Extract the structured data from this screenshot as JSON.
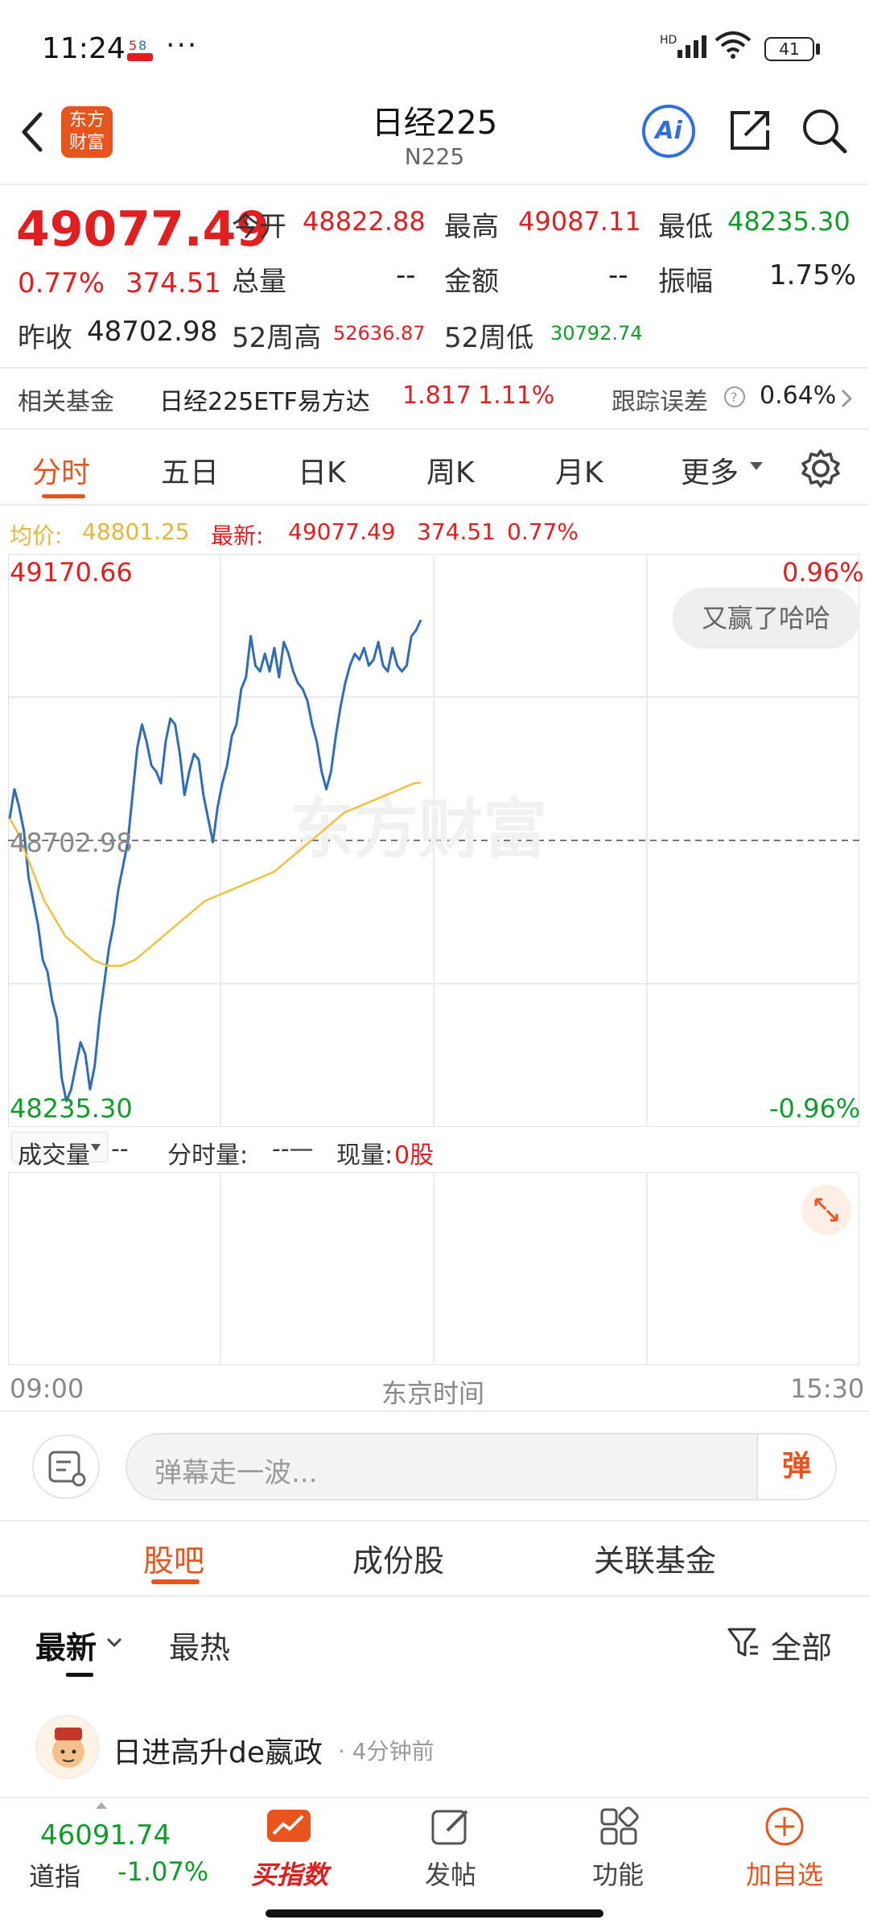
{
  "status_bar": {
    "time": "11:24",
    "dots": "···",
    "battery": "41",
    "network": "HD"
  },
  "header": {
    "title": "日经225",
    "subtitle": "N225",
    "logo_text": "东方财富",
    "ai_label": "Ai"
  },
  "quote": {
    "price": "49077.49",
    "change_pct": "0.77%",
    "change_abs": "374.51",
    "open_label": "今开",
    "open": "48822.88",
    "high_label": "最高",
    "high": "49087.11",
    "low_label": "最低",
    "low": "48235.30",
    "volume_label": "总量",
    "volume": "--",
    "amount_label": "金额",
    "amount": "--",
    "amplitude_label": "振幅",
    "amplitude": "1.75%",
    "prev_close_label": "昨收",
    "prev_close": "48702.98",
    "w52_high_label": "52周高",
    "w52_high": "52636.87",
    "w52_low_label": "52周低",
    "w52_low": "30792.74"
  },
  "fund": {
    "label": "相关基金",
    "name": "日经225ETF易方达",
    "price": "1.817",
    "change": "1.11%",
    "tracking_label": "跟踪误差",
    "tracking_value": "0.64%"
  },
  "tabs": [
    "分时",
    "五日",
    "日K",
    "周K",
    "月K",
    "更多"
  ],
  "info": {
    "avg_label": "均价:",
    "avg": "48801.25",
    "latest_label": "最新:",
    "latest": "49077.49",
    "change_abs": "374.51",
    "change_pct": "0.77%"
  },
  "chart_axis": {
    "top_price": "49170.66",
    "mid_price": "48702.98",
    "bottom_price": "48235.30",
    "top_pct": "0.96%",
    "bottom_pct": "-0.96%",
    "watermark": "东方财富",
    "bubble": "又赢了哈哈"
  },
  "volume_header": {
    "dropdown": "成交量",
    "dropdown_value": "--",
    "minute_vol_label": "分时量:",
    "minute_vol": "--—",
    "current_vol_label": "现量:",
    "current_vol": "0股"
  },
  "time_axis": {
    "start": "09:00",
    "middle": "东京时间",
    "end": "15:30"
  },
  "danmaku": {
    "placeholder": "弹幕走一波...",
    "fire_label": "弹"
  },
  "section_tabs": [
    "股吧",
    "成份股",
    "关联基金"
  ],
  "sort": {
    "latest": "最新",
    "hot": "最热",
    "filter": "全部"
  },
  "post": {
    "user": "日进高升de嬴政",
    "time": "· 4分钟前"
  },
  "bottom_bar": {
    "index_value": "46091.74",
    "index_name": "道指",
    "index_change": "-1.07%",
    "buy_label": "买指数",
    "post_label": "发帖",
    "func_label": "功能",
    "add_label": "加自选"
  },
  "chart_data": {
    "type": "line",
    "title": "",
    "xlabel": "东京时间",
    "ylabel": "",
    "x_range": [
      "09:00",
      "15:30"
    ],
    "ylim": [
      48235.3,
      49170.66
    ],
    "baseline": 48702.98,
    "series": [
      {
        "name": "",
        "color": "#2f6db5",
        "values": [
          48740,
          48790,
          48760,
          48720,
          48640,
          48600,
          48560,
          48500,
          48480,
          48430,
          48400,
          48300,
          48260,
          48280,
          48320,
          48360,
          48340,
          48280,
          48320,
          48400,
          48460,
          48520,
          48560,
          48620,
          48660,
          48700,
          48780,
          48860,
          48900,
          48870,
          48830,
          48820,
          48800,
          48870,
          48910,
          48900,
          48850,
          48780,
          48820,
          48850,
          48840,
          48780,
          48740,
          48700,
          48760,
          48800,
          48830,
          48880,
          48900,
          48960,
          48980,
          49050,
          49000,
          48990,
          49020,
          48990,
          49030,
          48980,
          49040,
          49020,
          48990,
          48970,
          48960,
          48940,
          48900,
          48870,
          48820,
          48790,
          48820,
          48880,
          48930,
          48970,
          49000,
          49020,
          49010,
          49030,
          49000,
          49010,
          49040,
          49000,
          48990,
          49030,
          49000,
          48990,
          49000,
          49050,
          49060,
          49077.49
        ]
      },
      {
        "name": "",
        "color": "#f0c040",
        "values": [
          48740,
          48720,
          48690,
          48660,
          48630,
          48600,
          48580,
          48560,
          48540,
          48530,
          48520,
          48510,
          48500,
          48495,
          48490,
          48490,
          48490,
          48495,
          48500,
          48510,
          48520,
          48530,
          48540,
          48550,
          48560,
          48570,
          48580,
          48590,
          48600,
          48605,
          48610,
          48615,
          48620,
          48625,
          48630,
          48635,
          48640,
          48645,
          48650,
          48660,
          48670,
          48680,
          48690,
          48700,
          48710,
          48720,
          48730,
          48740,
          48750,
          48755,
          48760,
          48765,
          48770,
          48775,
          48780,
          48785,
          48790,
          48795,
          48800,
          48801.25
        ]
      }
    ]
  },
  "colors": {
    "up": "#e02020",
    "down": "#0f9d2a",
    "accent": "#e8541e",
    "line_blue": "#2f6db5",
    "avg_yellow": "#f0c040"
  }
}
